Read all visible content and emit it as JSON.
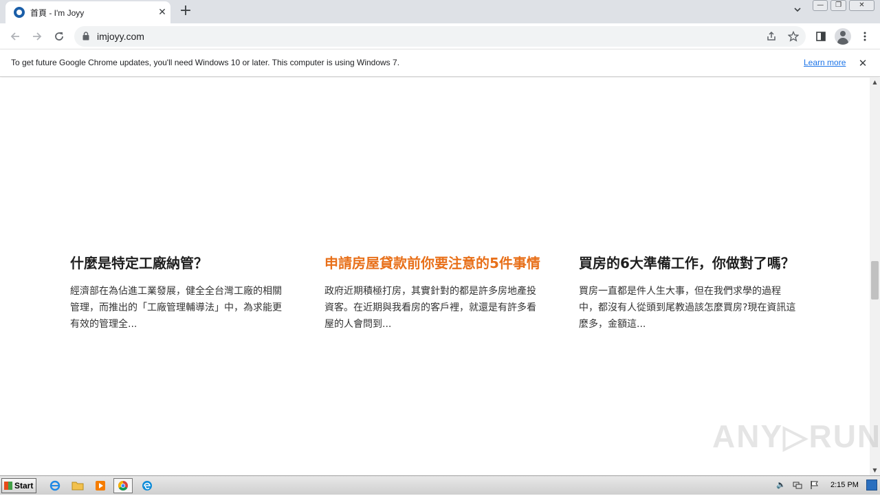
{
  "browser": {
    "tab": {
      "title": "首頁 - I'm Joyy",
      "close_symbol": "✕"
    },
    "newtab_symbol": "+",
    "tab_search_symbol": "⌄",
    "window_buttons": [
      "—",
      "❐",
      "✕"
    ],
    "url": "imjoyy.com"
  },
  "infobar": {
    "message": "To get future Google Chrome updates, you'll need Windows 10 or later. This computer is using Windows 7.",
    "link": "Learn more",
    "close_symbol": "✕"
  },
  "page": {
    "cards": [
      {
        "title": "什麼是特定工廠納管？",
        "excerpt": "經濟部在為佔進工業發展，健全全台灣工廠的相關管理，而推出的「工廠管理輔導法」中，為求能更有效的管理全..."
      },
      {
        "title": "申請房屋貸款前你要注意的5件事情",
        "excerpt": "政府近期積極打房，其實針對的都是許多房地產投資客。在近期與我看房的客戶裡，就還是有許多看屋的人會問到..."
      },
      {
        "title": "買房的6大準備工作，你做對了嗎？",
        "excerpt": "買房一直都是件人生大事，但在我們求學的過程中，都沒有人從頭到尾教過該怎麼買房?現在資訊這麼多，金額這..."
      }
    ],
    "accent_color": "#e8701a"
  },
  "watermark": "ANY▷RUN",
  "taskbar": {
    "start_label": "Start",
    "clock": "2:15 PM"
  }
}
